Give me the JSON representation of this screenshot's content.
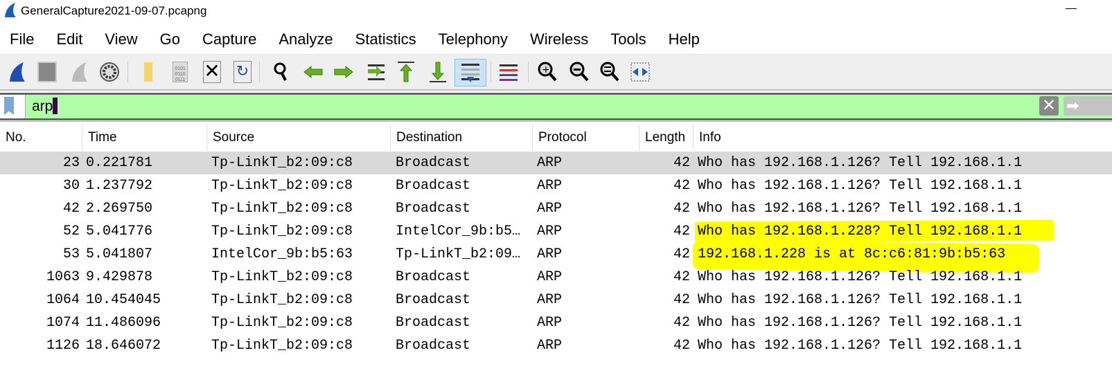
{
  "window": {
    "title": "GeneralCapture2021-09-07.pcapng"
  },
  "menu": [
    "File",
    "Edit",
    "View",
    "Go",
    "Capture",
    "Analyze",
    "Statistics",
    "Telephony",
    "Wireless",
    "Tools",
    "Help"
  ],
  "toolbar": {
    "icons": [
      "start-capture-icon",
      "stop-capture-icon",
      "restart-capture-icon",
      "capture-options-icon",
      "open-file-icon",
      "save-file-icon",
      "close-file-icon",
      "reload-file-icon",
      "find-packet-icon",
      "go-back-icon",
      "go-forward-icon",
      "go-to-packet-icon",
      "go-first-icon",
      "go-last-icon",
      "autoscroll-icon",
      "colorize-icon",
      "zoom-in-icon",
      "zoom-out-icon",
      "zoom-normal-icon",
      "resize-columns-icon"
    ]
  },
  "filter": {
    "value": "arp",
    "filter_color": "#afffa9"
  },
  "columns": [
    "No.",
    "Time",
    "Source",
    "Destination",
    "Protocol",
    "Length",
    "Info"
  ],
  "packets": [
    {
      "no": "23",
      "time": "0.221781",
      "src": "Tp-LinkT_b2:09:c8",
      "dst": "Broadcast",
      "proto": "ARP",
      "len": "42",
      "info": "Who has 192.168.1.126? Tell 192.168.1.1",
      "selected": true
    },
    {
      "no": "30",
      "time": "1.237792",
      "src": "Tp-LinkT_b2:09:c8",
      "dst": "Broadcast",
      "proto": "ARP",
      "len": "42",
      "info": "Who has 192.168.1.126? Tell 192.168.1.1"
    },
    {
      "no": "42",
      "time": "2.269750",
      "src": "Tp-LinkT_b2:09:c8",
      "dst": "Broadcast",
      "proto": "ARP",
      "len": "42",
      "info": "Who has 192.168.1.126? Tell 192.168.1.1"
    },
    {
      "no": "52",
      "time": "5.041776",
      "src": "Tp-LinkT_b2:09:c8",
      "dst": "IntelCor_9b:b5…",
      "proto": "ARP",
      "len": "42",
      "info": "Who has 192.168.1.228? Tell 192.168.1.1",
      "highlighted": true
    },
    {
      "no": "53",
      "time": "5.041807",
      "src": "IntelCor_9b:b5:63",
      "dst": "Tp-LinkT_b2:09…",
      "proto": "ARP",
      "len": "42",
      "info": "192.168.1.228 is at 8c:c6:81:9b:b5:63",
      "highlighted": true
    },
    {
      "no": "1063",
      "time": "9.429878",
      "src": "Tp-LinkT_b2:09:c8",
      "dst": "Broadcast",
      "proto": "ARP",
      "len": "42",
      "info": "Who has 192.168.1.126? Tell 192.168.1.1"
    },
    {
      "no": "1064",
      "time": "10.454045",
      "src": "Tp-LinkT_b2:09:c8",
      "dst": "Broadcast",
      "proto": "ARP",
      "len": "42",
      "info": "Who has 192.168.1.126? Tell 192.168.1.1"
    },
    {
      "no": "1074",
      "time": "11.486096",
      "src": "Tp-LinkT_b2:09:c8",
      "dst": "Broadcast",
      "proto": "ARP",
      "len": "42",
      "info": "Who has 192.168.1.126? Tell 192.168.1.1"
    },
    {
      "no": "1126",
      "time": "18.646072",
      "src": "Tp-LinkT_b2:09:c8",
      "dst": "Broadcast",
      "proto": "ARP",
      "len": "42",
      "info": "Who has 192.168.1.126? Tell 192.168.1.1"
    }
  ],
  "highlight_color": "#ffff00"
}
